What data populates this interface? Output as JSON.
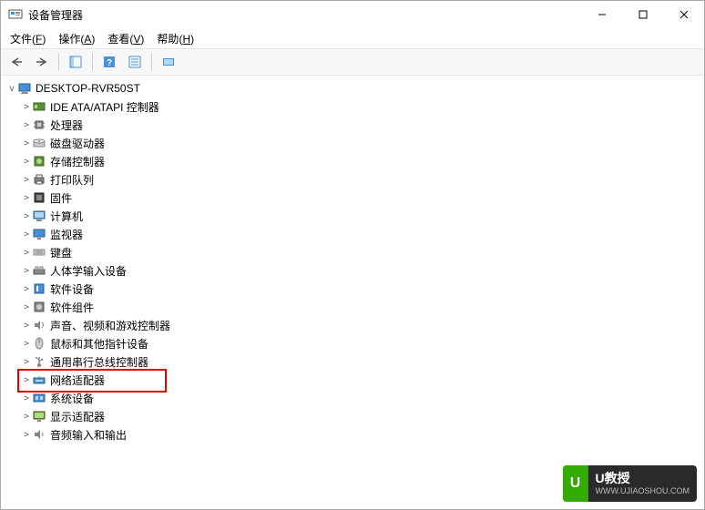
{
  "window": {
    "title": "设备管理器",
    "controls": {
      "min": "minimize",
      "max": "maximize",
      "close": "close"
    }
  },
  "menu": {
    "file": {
      "label": "文件",
      "key": "F"
    },
    "action": {
      "label": "操作",
      "key": "A"
    },
    "view": {
      "label": "查看",
      "key": "V"
    },
    "help": {
      "label": "帮助",
      "key": "H"
    }
  },
  "toolbar": {
    "back": "←",
    "forward": "→"
  },
  "tree": {
    "root": {
      "label": "DESKTOP-RVR50ST",
      "expanded": true
    },
    "nodes": [
      {
        "label": "IDE ATA/ATAPI 控制器",
        "icon": "ide"
      },
      {
        "label": "处理器",
        "icon": "cpu"
      },
      {
        "label": "磁盘驱动器",
        "icon": "disk"
      },
      {
        "label": "存储控制器",
        "icon": "storage"
      },
      {
        "label": "打印队列",
        "icon": "printer"
      },
      {
        "label": "固件",
        "icon": "firmware"
      },
      {
        "label": "计算机",
        "icon": "computer"
      },
      {
        "label": "监视器",
        "icon": "monitor"
      },
      {
        "label": "键盘",
        "icon": "keyboard"
      },
      {
        "label": "人体学输入设备",
        "icon": "hid"
      },
      {
        "label": "软件设备",
        "icon": "software"
      },
      {
        "label": "软件组件",
        "icon": "component"
      },
      {
        "label": "声音、视频和游戏控制器",
        "icon": "sound"
      },
      {
        "label": "鼠标和其他指针设备",
        "icon": "mouse"
      },
      {
        "label": "通用串行总线控制器",
        "icon": "usb"
      },
      {
        "label": "网络适配器",
        "icon": "network",
        "highlight": true
      },
      {
        "label": "系统设备",
        "icon": "system"
      },
      {
        "label": "显示适配器",
        "icon": "display"
      },
      {
        "label": "音频输入和输出",
        "icon": "audio"
      }
    ]
  },
  "watermark": {
    "brand": "U教授",
    "url": "WWW.UJIAOSHOU.COM",
    "icon_letter": "U"
  }
}
